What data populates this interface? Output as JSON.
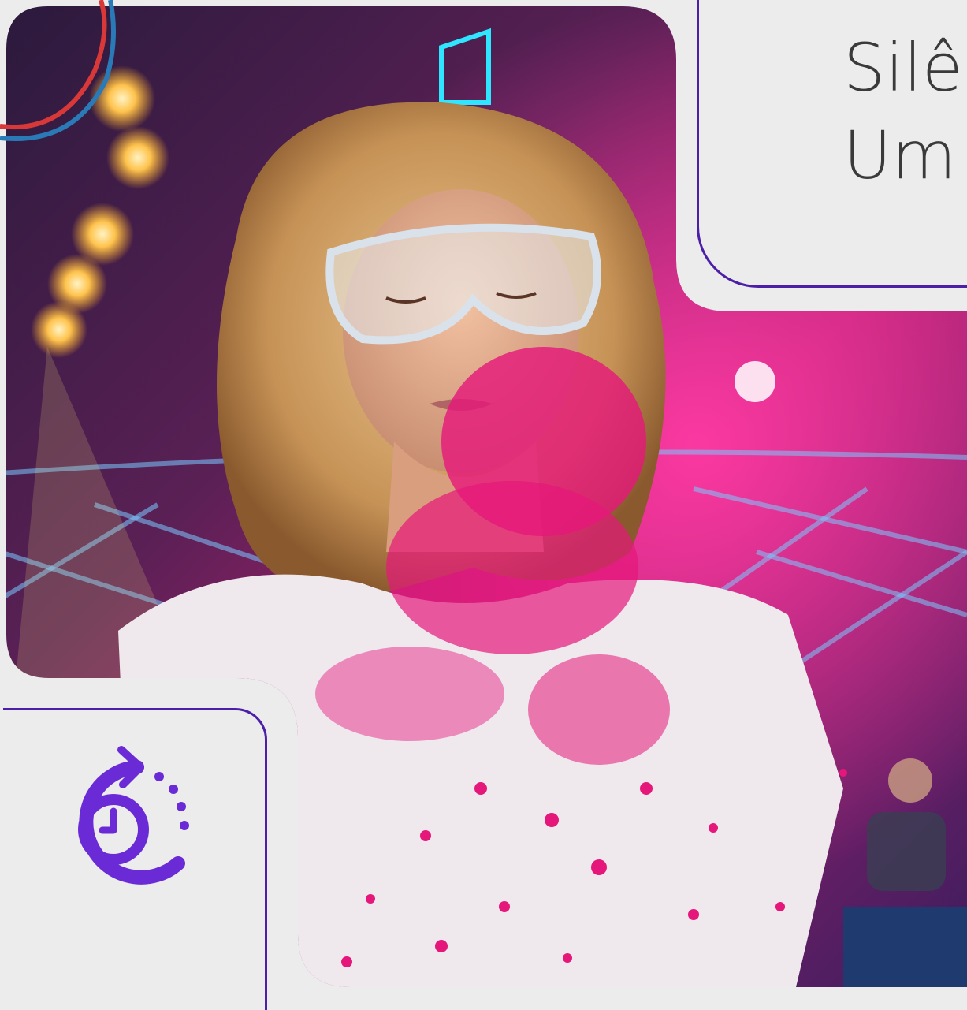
{
  "heading": {
    "line1": "Silê",
    "line2": "Um"
  },
  "icons": {
    "timer": "clock-rotate-icon"
  },
  "colors": {
    "accent": "#4b1fa8",
    "icon": "#6a2bd6",
    "background": "#ececec",
    "powder": "#e6177a"
  }
}
